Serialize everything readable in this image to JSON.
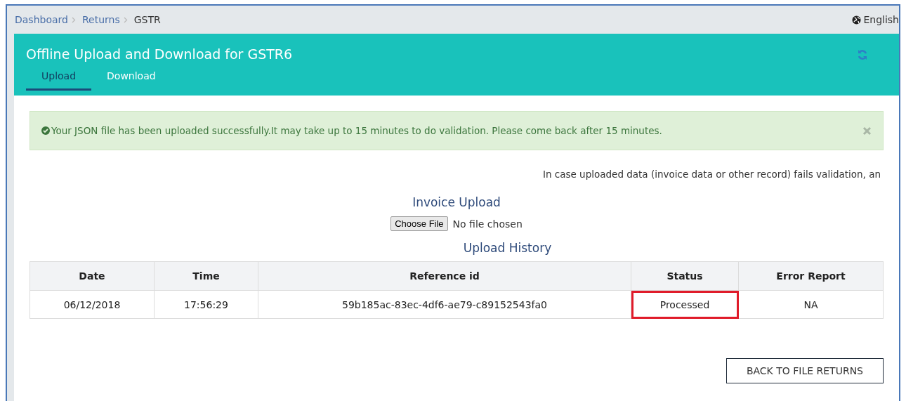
{
  "breadcrumb": [
    {
      "label": "Dashboard",
      "link": true
    },
    {
      "label": "Returns",
      "link": true
    },
    {
      "label": "GSTR",
      "link": false
    }
  ],
  "language": "English",
  "header": {
    "title": "Offline Upload and Download for GSTR6"
  },
  "tabs": [
    {
      "label": "Upload",
      "selected": true
    },
    {
      "label": "Download",
      "selected": false
    }
  ],
  "alert": {
    "message": "Your JSON file has been uploaded successfully.It may take up to 15 minutes to do validation. Please come back after 15 minutes."
  },
  "info_text": "In case uploaded data (invoice data or other record) fails validation, an",
  "upload": {
    "heading": "Invoice Upload",
    "button": "Choose File",
    "file_status": "No file chosen"
  },
  "history": {
    "heading": "Upload History",
    "columns": [
      "Date",
      "Time",
      "Reference id",
      "Status",
      "Error Report"
    ],
    "rows": [
      {
        "date": "06/12/2018",
        "time": "17:56:29",
        "reference_id": "59b185ac-83ec-4df6-ae79-c89152543fa0",
        "status": "Processed",
        "error_report": "NA",
        "status_highlighted": true
      }
    ]
  },
  "back_button": "BACK TO FILE RETURNS"
}
